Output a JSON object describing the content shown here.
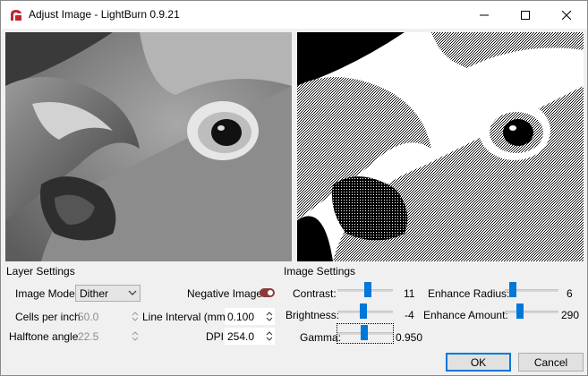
{
  "window": {
    "title": "Adjust Image - LightBurn 0.9.21"
  },
  "layer_settings": {
    "title": "Layer Settings",
    "image_mode_label": "Image Mode:",
    "image_mode_value": "Dither",
    "negative_image_label": "Negative Image",
    "negative_image_on": true,
    "cells_per_inch_label": "Cells per inch",
    "cells_per_inch_value": "50.0",
    "line_interval_label": "Line Interval (mm)",
    "line_interval_value": "0.100",
    "halftone_angle_label": "Halftone angle",
    "halftone_angle_value": "22.5",
    "dpi_label": "DPI",
    "dpi_value": "254.0"
  },
  "image_settings": {
    "title": "Image Settings",
    "contrast_label": "Contrast:",
    "contrast_value": "11",
    "brightness_label": "Brightness:",
    "brightness_value": "-4",
    "gamma_label": "Gamma:",
    "gamma_value": "0.950",
    "enhance_radius_label": "Enhance Radius:",
    "enhance_radius_value": "6",
    "enhance_amount_label": "Enhance Amount:",
    "enhance_amount_value": "290"
  },
  "buttons": {
    "ok": "OK",
    "cancel": "Cancel"
  },
  "colors": {
    "accent": "#0078d7",
    "toggle": "#8b3a3a",
    "app_icon": "#c1272d"
  }
}
